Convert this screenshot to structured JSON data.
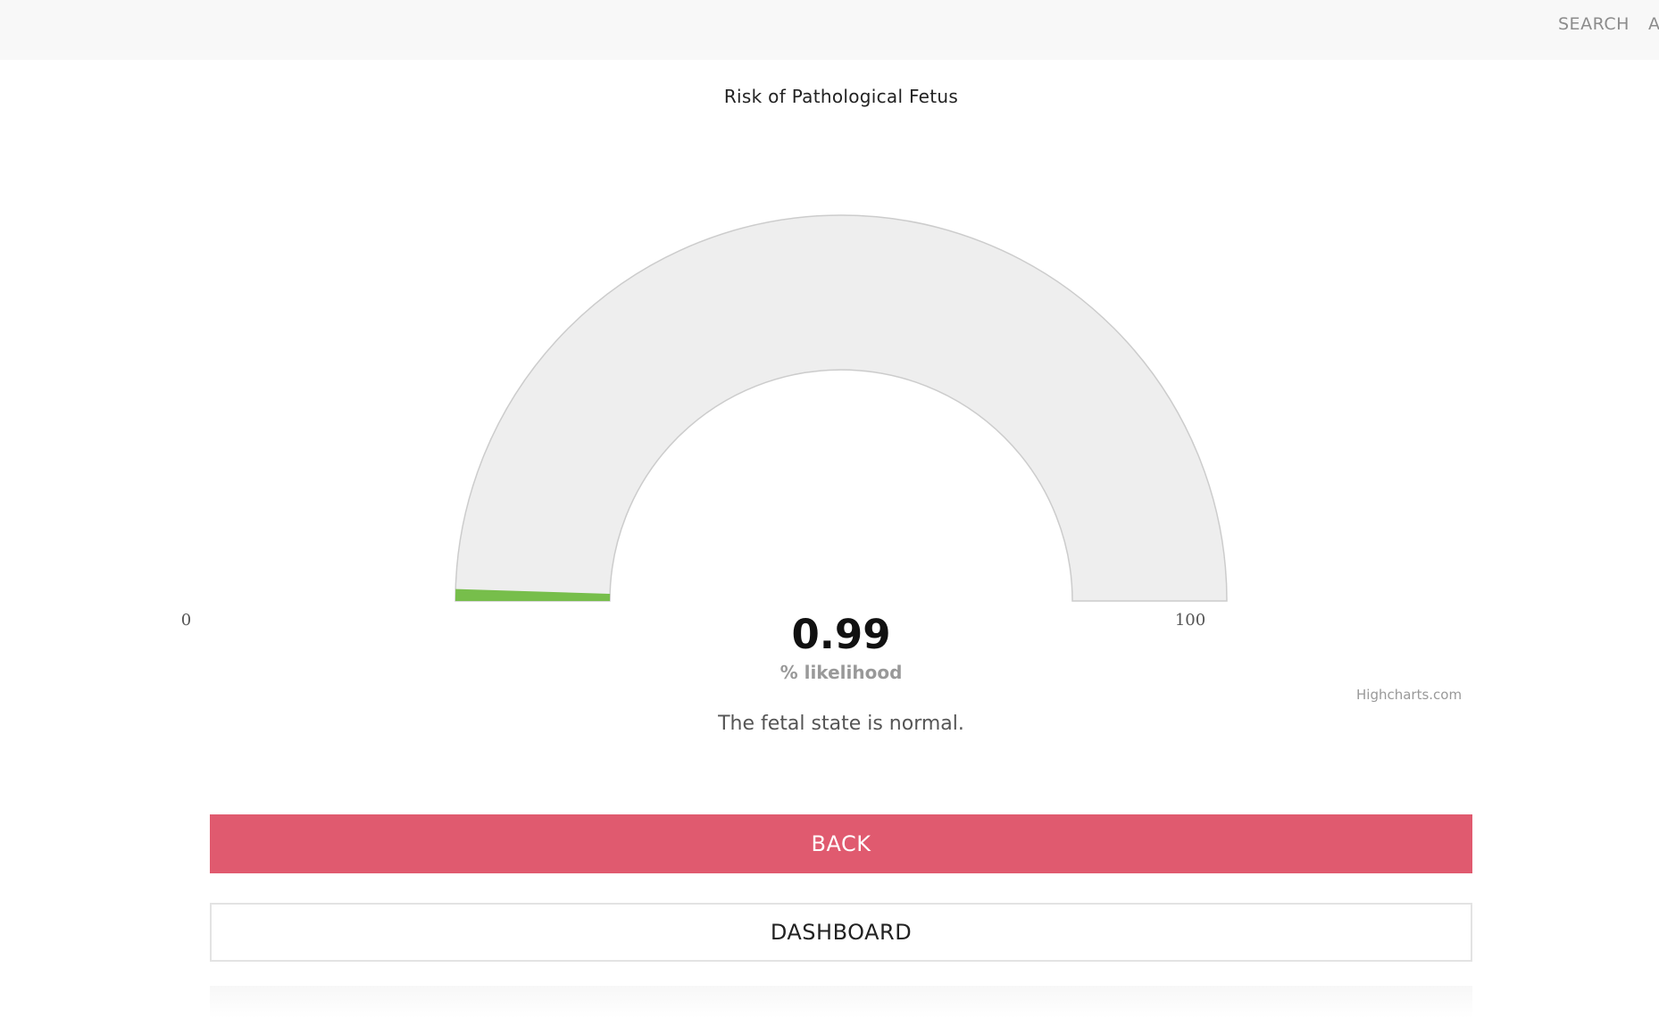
{
  "nav": {
    "search_label": "SEARCH",
    "a_label": "A"
  },
  "chart_data": {
    "type": "solidgauge",
    "title": "Risk of Pathological Fetus",
    "min": 0,
    "max": 100,
    "min_label": "0",
    "max_label": "100",
    "value": 0.99,
    "value_label": "0.99",
    "unit_label": "% likelihood",
    "fill_color": "#77be4b",
    "background_color": "#eeeeee",
    "credits": "Highcharts.com"
  },
  "status": {
    "message": "The fetal state is normal."
  },
  "buttons": {
    "back_label": "BACK",
    "dashboard_label": "DASHBOARD"
  },
  "colors": {
    "back_button": "#e05a6f",
    "topbar": "#f8f8f8"
  }
}
